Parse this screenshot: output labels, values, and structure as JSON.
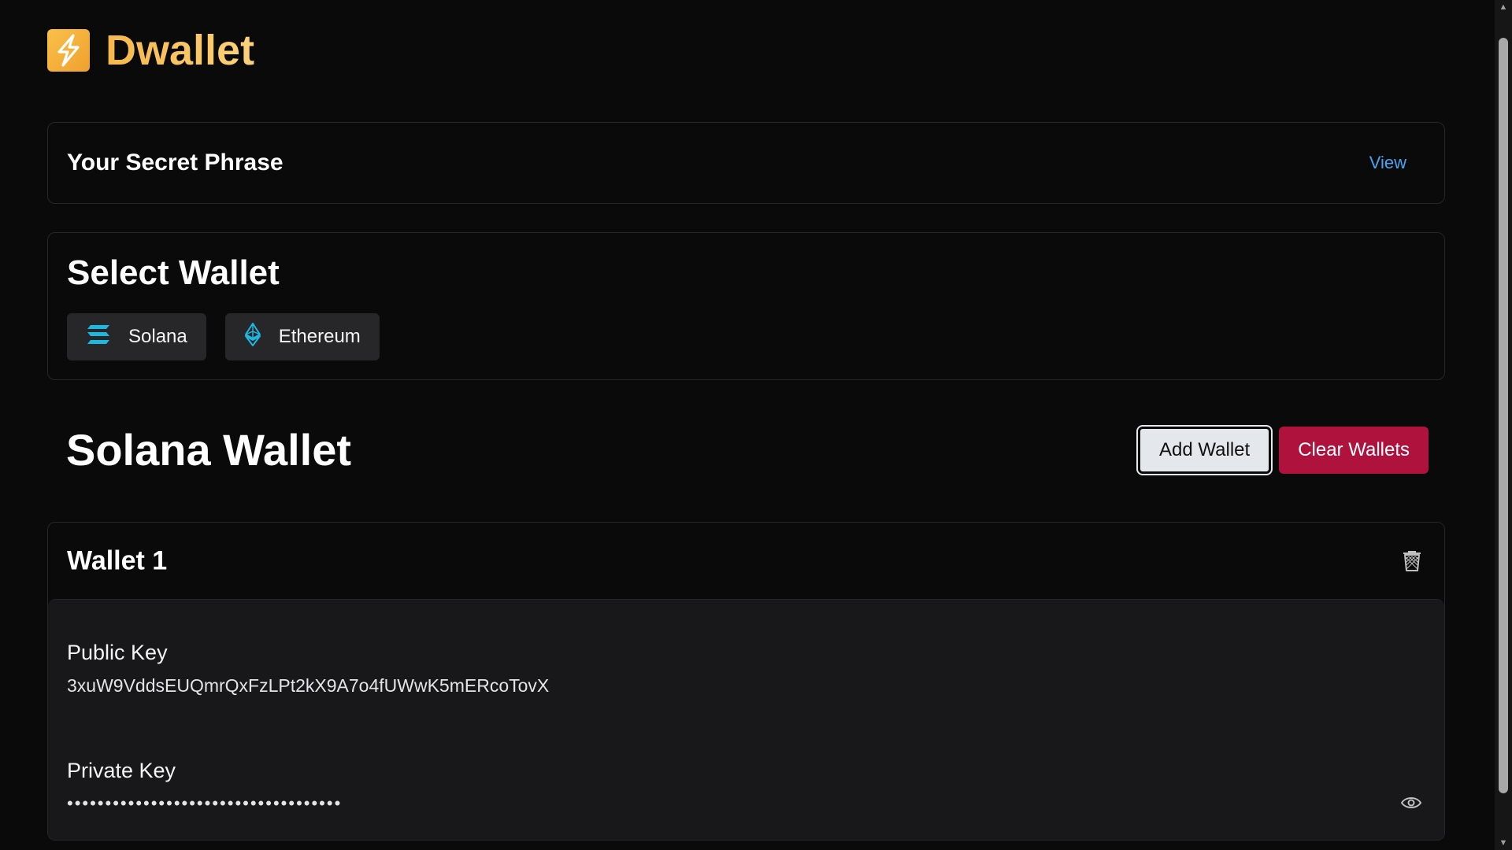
{
  "app": {
    "name": "Dwallet",
    "logo_icon": "lightning-logo-icon",
    "accent": "#f7b84a"
  },
  "secret_phrase": {
    "title": "Your Secret Phrase",
    "action_label": "View"
  },
  "select_wallet": {
    "title": "Select Wallet",
    "chains": [
      {
        "label": "Solana",
        "icon": "solana-icon",
        "color": "#1fb6e0"
      },
      {
        "label": "Ethereum",
        "icon": "ethereum-icon",
        "color": "#1fb6e0"
      }
    ]
  },
  "wallet_section": {
    "title": "Solana Wallet",
    "add_label": "Add Wallet",
    "clear_label": "Clear Wallets",
    "clear_color": "#b0123e"
  },
  "wallets": [
    {
      "name": "Wallet 1",
      "public_key_label": "Public Key",
      "public_key": "3xuW9VddsEUQmrQxFzLPt2kX9A7o4fUWwK5mERcoTovX",
      "private_key_label": "Private Key",
      "private_key_masked": "••••••••••••••••••••••••••••••••••••"
    }
  ]
}
